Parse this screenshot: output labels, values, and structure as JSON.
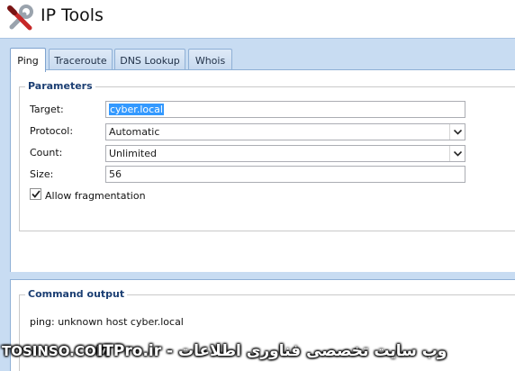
{
  "app": {
    "title": "IP Tools",
    "icon": "tools-icon"
  },
  "tabs": [
    {
      "label": "Ping",
      "active": true
    },
    {
      "label": "Traceroute",
      "active": false
    },
    {
      "label": "DNS Lookup",
      "active": false
    },
    {
      "label": "Whois",
      "active": false
    }
  ],
  "parameters": {
    "title": "Parameters",
    "target": {
      "label": "Target:",
      "value": "cyber.local"
    },
    "protocol": {
      "label": "Protocol:",
      "value": "Automatic"
    },
    "count": {
      "label": "Count:",
      "value": "Unlimited"
    },
    "size": {
      "label": "Size:",
      "value": "56"
    },
    "allow_fragmentation": {
      "label": "Allow fragmentation",
      "checked": true
    }
  },
  "output": {
    "title": "Command output",
    "text": "ping: unknown host cyber.local"
  },
  "watermark": {
    "left": "TOSINSO.COM",
    "right": "وب سایت تخصصی فناوری اطلاعات - ITPro.ir"
  },
  "colors": {
    "tab_strip": "#c8dcf2",
    "group_title": "#1c3f73",
    "selection": "#3399ff"
  }
}
